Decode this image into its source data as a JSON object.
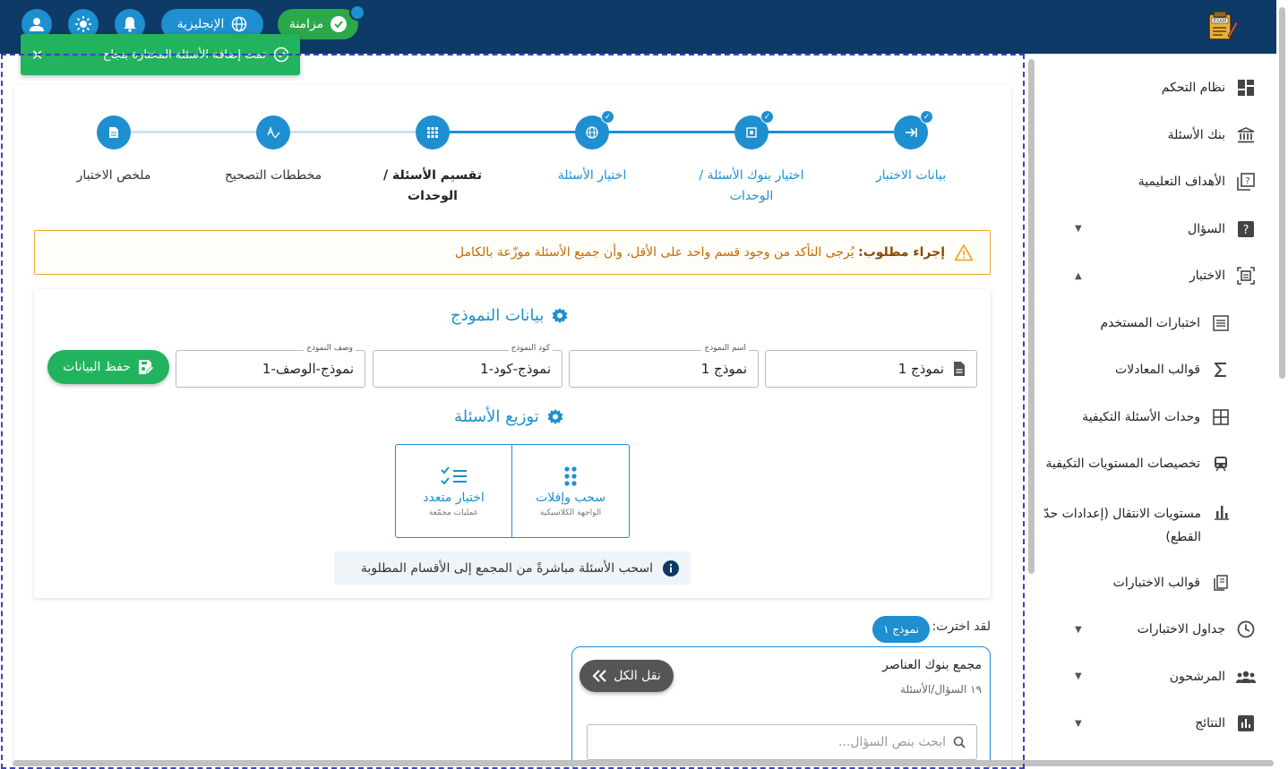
{
  "topbar": {
    "sync_label": "مزامنة",
    "language_label": "الإنجليزية",
    "logo_text": "EXAM"
  },
  "toast": {
    "message": "تمت إضافة الأسئلة المختارة بنجاح"
  },
  "sidebar": {
    "items": [
      {
        "label": "نظام التحكم",
        "icon": "dashboard-icon"
      },
      {
        "label": "بنك الأسئلة",
        "icon": "bank-icon"
      },
      {
        "label": "الأهداف التعليمية",
        "icon": "objectives-icon"
      },
      {
        "label": "السؤال",
        "icon": "question-icon",
        "caret": "down"
      },
      {
        "label": "الاختبار",
        "icon": "exam-icon",
        "caret": "up"
      },
      {
        "label": "اختبارات المستخدم",
        "icon": "list-icon"
      },
      {
        "label": "قوالب المعادلات",
        "icon": "sigma-icon"
      },
      {
        "label": "وحدات الأسئلة التكيفية",
        "icon": "grid-icon"
      },
      {
        "label": "تخصيصات المستويات التكيفية",
        "icon": "train-icon"
      },
      {
        "label": "مستويات الانتقال (إعدادات حدّ القطع)",
        "icon": "bar-chart-icon"
      },
      {
        "label": "قوالب الاختبارات",
        "icon": "template-icon"
      },
      {
        "label": "جداول الاختبارات",
        "icon": "clock-icon",
        "caret": "down"
      },
      {
        "label": "المرشحون",
        "icon": "people-icon",
        "caret": "down"
      },
      {
        "label": "النتائج",
        "icon": "results-icon",
        "caret": "down"
      }
    ]
  },
  "stepper": {
    "steps": [
      {
        "label": "بيانات الاختبار",
        "state": "done"
      },
      {
        "label": "اختيار بنوك الأسئلة / الوحدات",
        "state": "done"
      },
      {
        "label": "اختيار الأسئلة",
        "state": "done"
      },
      {
        "label": "تقسيم الأسئلة / الوحدات",
        "state": "active"
      },
      {
        "label": "مخططات التصحيح",
        "state": "todo"
      },
      {
        "label": "ملخص الاختبار",
        "state": "todo"
      }
    ]
  },
  "alert": {
    "bold": "إجراء مطلوب:",
    "text": "يُرجى التأكد من وجود قسم واحد على الأقل، وأن جميع الأسئلة موزّعة بالكامل"
  },
  "model": {
    "title": "بيانات النموذج",
    "fields": [
      {
        "label": "",
        "value": "نموذج 1"
      },
      {
        "label": "اسم النموذج",
        "value": "نموذج 1"
      },
      {
        "label": "كود النموذج",
        "value": "نموذج-كود-1"
      },
      {
        "label": "وصف النموذج",
        "value": "نموذج-الوصف-1"
      }
    ],
    "save_label": "حفظ البيانات"
  },
  "distribution": {
    "title": "توزيع الأسئلة",
    "options": [
      {
        "title": "سحب وإفلات",
        "sub": "الواجهة الكلاسيكية"
      },
      {
        "title": "اختيار متعدد",
        "sub": "عمليات مجمّعة"
      }
    ],
    "info": "اسحب الأسئلة مباشرةً من المجمع إلى الأقسام المطلوبة"
  },
  "selection": {
    "label": "لقد اخترت:",
    "chip": "نموذج ١"
  },
  "pool": {
    "title": "مجمع بنوك العناصر",
    "count": "١٩ السؤال/الأسئلة",
    "move_all_label": "نقل الكل",
    "search_placeholder": "ابحث بنص السؤال..."
  },
  "colors": {
    "topbar": "#0d3a66",
    "primary": "#1e8fd0",
    "success": "#22b35e",
    "warning": "#f0a830"
  }
}
